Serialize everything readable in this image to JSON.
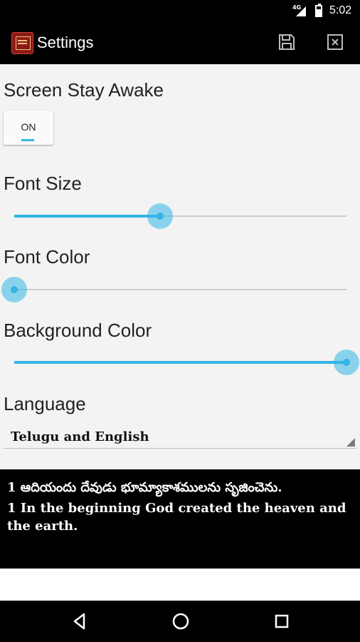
{
  "status_bar": {
    "network": "4G",
    "time": "5:02",
    "icons": [
      "signal-icon",
      "battery-icon"
    ]
  },
  "action_bar": {
    "title": "Settings",
    "app_icon": "bible-app-icon",
    "actions": [
      {
        "name": "save",
        "icon": "save-icon"
      },
      {
        "name": "discard",
        "icon": "close-icon"
      }
    ]
  },
  "settings": {
    "screen_awake": {
      "label": "Screen Stay Awake",
      "toggle_text": "ON"
    },
    "font_size": {
      "label": "Font Size",
      "value": 0.44
    },
    "font_color": {
      "label": "Font Color",
      "value": 0.0
    },
    "background_color": {
      "label": "Background Color",
      "value": 1.0
    },
    "language": {
      "label": "Language",
      "selected": "Telugu and English"
    }
  },
  "preview": {
    "telugu": "1 ఆదియందు దేవుడు భూమ్యాకాశములను సృజించెను.",
    "english": "1 In the beginning God created the heaven and the earth."
  },
  "colors": {
    "accent": "#33b5e5",
    "action_bar": "#000000",
    "background": "#f3f3f3",
    "preview_background": "#000000",
    "preview_text": "#ffffff"
  },
  "nav_bar": {
    "buttons": [
      "back-icon",
      "home-icon",
      "recent-apps-icon"
    ]
  }
}
